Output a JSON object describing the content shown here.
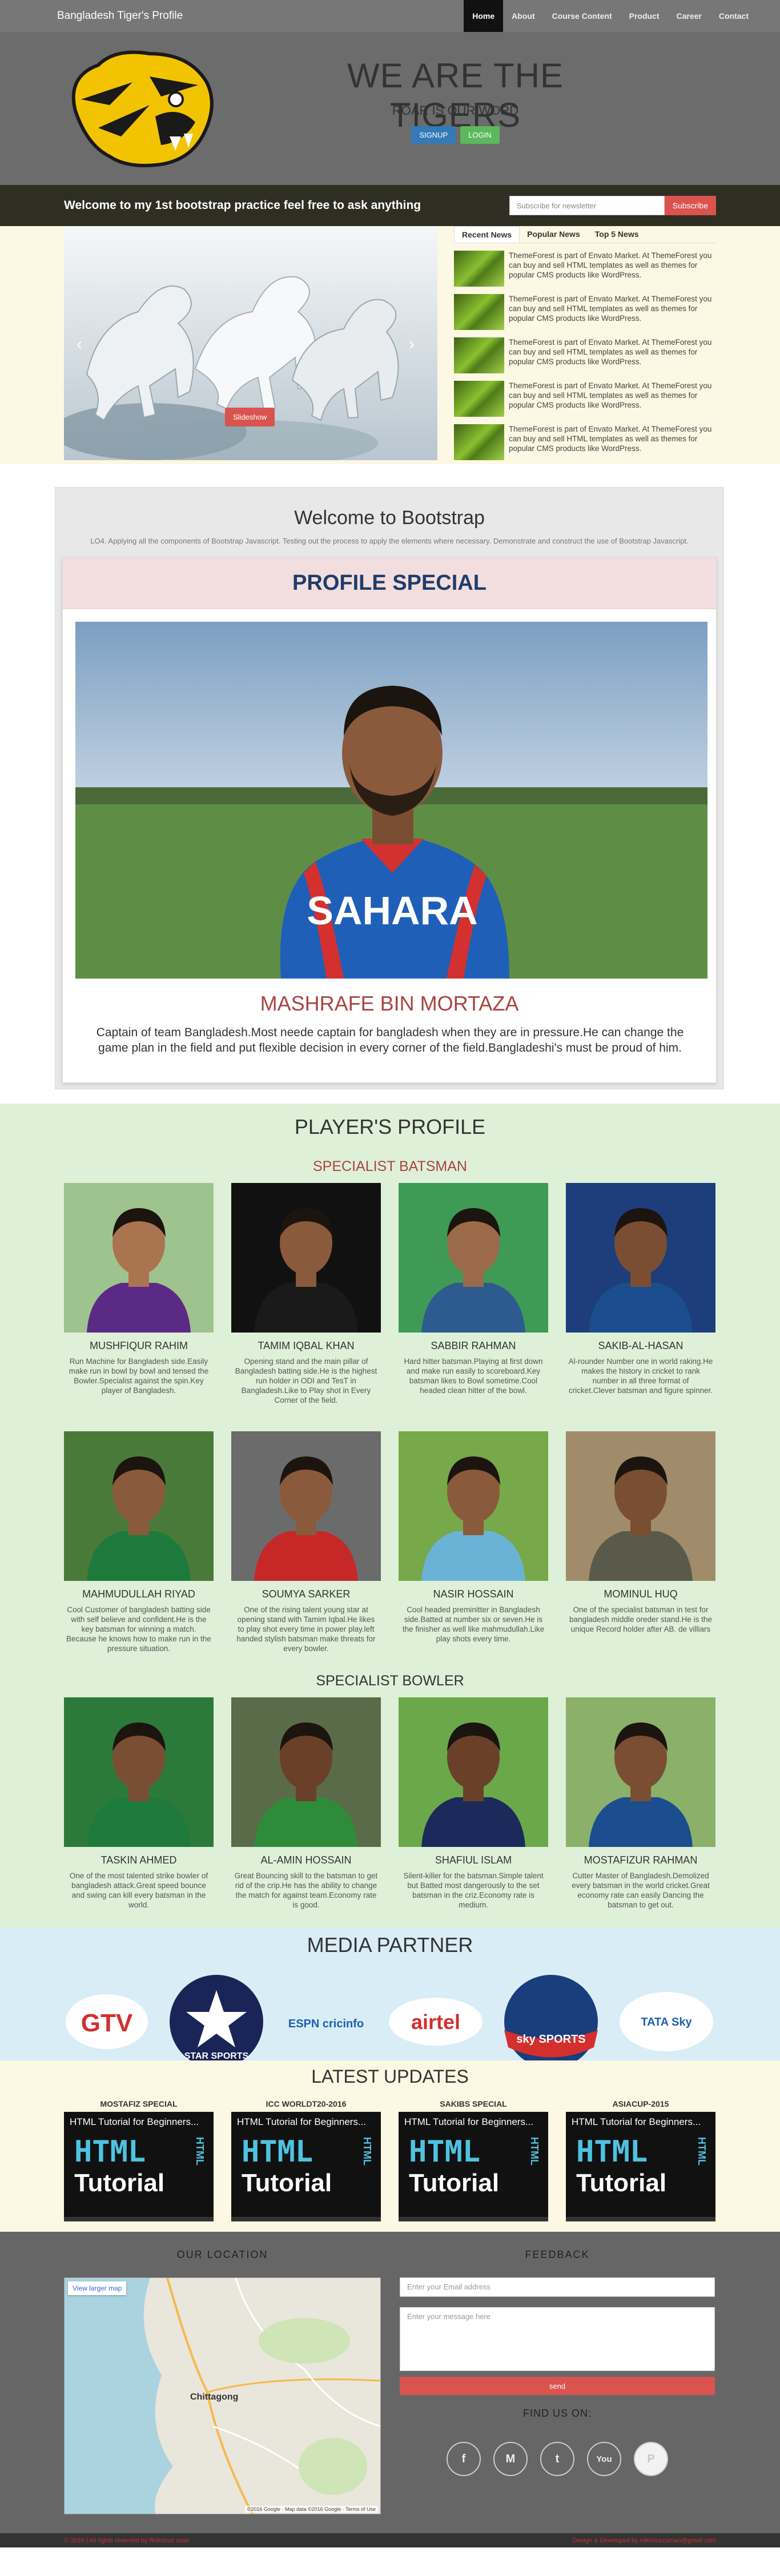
{
  "nav": {
    "brand": "Bangladesh Tiger's Profile",
    "links": [
      "Home",
      "About",
      "Course Content",
      "Product",
      "Career",
      "Contact"
    ]
  },
  "hero": {
    "title": "WE ARE THE TIGERS",
    "subtitle": "ROAR IS OUR WORD",
    "signup": "SIGNUP",
    "login": "LOGIN"
  },
  "welcome_bar": {
    "text": "Welcome to my 1st bootstrap practice feel free to ask anything",
    "placeholder": "Subscribe for newsletter",
    "button": "Subscribe"
  },
  "carousel": {
    "button": "Slideshow",
    "prev": "‹",
    "next": "›"
  },
  "news": {
    "tabs": [
      "Recent News",
      "Popular News",
      "Top 5 News"
    ],
    "items": [
      "ThemeForest is part of Envato Market. At ThemeForest you can buy and sell HTML templates as well as themes for popular CMS products like WordPress.",
      "ThemeForest is part of Envato Market. At ThemeForest you can buy and sell HTML templates as well as themes for popular CMS products like WordPress.",
      "ThemeForest is part of Envato Market. At ThemeForest you can buy and sell HTML templates as well as themes for popular CMS products like WordPress.",
      "ThemeForest is part of Envato Market. At ThemeForest you can buy and sell HTML templates as well as themes for popular CMS products like WordPress.",
      "ThemeForest is part of Envato Market. At ThemeForest you can buy and sell HTML templates as well as themes for popular CMS products like WordPress."
    ]
  },
  "bootstrap": {
    "title": "Welcome to Bootstrap",
    "description": "LO4. Applying all the components of Bootstrap Javascript. Testing out the process to apply the elements where necessary. Demonstrate and construct the use of Bootstrap Javascript."
  },
  "profile": {
    "heading": "PROFILE SPECIAL",
    "jersey": "SAHARA",
    "name": "MASHRAFE BIN MORTAZA",
    "text": "Captain of team Bangladesh.Most neede captain for bangladesh when they are in pressure.He can change the game plan in the field and put flexible decision in every corner of the field.Bangladeshi's must be proud of him."
  },
  "players": {
    "title": "PLAYER'S PROFILE",
    "batsman_title": "SPECIALIST BATSMAN",
    "bowler_title": "SPECIALIST BOWLER",
    "batsmen": [
      {
        "name": "MUSHFIQUR RAHIM",
        "desc": "Run Machine for Bangladesh side.Easily make run in bowl by bowl and tensed the Bowler.Specialist against the spin.Key player of Bangladesh.",
        "bg": "#9fc38f",
        "shirt": "#5b2a86",
        "skin": "#a9744f"
      },
      {
        "name": "TAMIM IQBAL KHAN",
        "desc": "Opening stand and the main pillar of Bangladesh batting side.He is the highest run holder in ODI and TesT in Bangladesh.Like to Play shot in Every Corner of the field.",
        "bg": "#111111",
        "shirt": "#1a1a1a",
        "skin": "#8a5a3c"
      },
      {
        "name": "SABBIR RAHMAN",
        "desc": "Hard hitter batsman.Playing at first down and make run easily to scoreboard.Key batsman likes to Bowl sometime.Cool headed clean hitter of the bowl.",
        "bg": "#3f9a55",
        "shirt": "#2d5b8f",
        "skin": "#9a6a4a"
      },
      {
        "name": "SAKIB-AL-HASAN",
        "desc": "Al-rounder Number one in world raking.He makes the history in cricket to rank number in all three format of cricket.Clever batsman and figure spinner.",
        "bg": "#1d3e7a",
        "shirt": "#1b4d8f",
        "skin": "#7a4e33"
      },
      {
        "name": "MAHMUDULLAH RIYAD",
        "desc": "Cool Customer of bangladesh batting side with self believe and confident.He is the key batsman for winning a match. Because he knows how to make run in the pressure situation.",
        "bg": "#4a7a3a",
        "shirt": "#1e7a3c",
        "skin": "#8a5a3c"
      },
      {
        "name": "SOUMYA SARKER",
        "desc": "One of the rising talent young star at opening stand with Tamim Iqbal.He likes to play shot every time in power play.left handed stylish batsman make threats for every bowler.",
        "bg": "#6b6b6b",
        "shirt": "#c62828",
        "skin": "#8a5a3c"
      },
      {
        "name": "NASIR HOSSAIN",
        "desc": "Cool headed preminitter in Bangladesh side.Batted at number six or seven.He is the finisher as well like mahmudullah.Like play shots every time.",
        "bg": "#77a84a",
        "shirt": "#6bb3d6",
        "skin": "#8a5a3c"
      },
      {
        "name": "MOMINUL HUQ",
        "desc": "One of the specialist batsman in test for bangladesh middle oreder stand.He is the unique Record holder after AB. de villiars",
        "bg": "#a08c6a",
        "shirt": "#5a5a4a",
        "skin": "#7a4e33"
      }
    ],
    "bowlers": [
      {
        "name": "TASKIN AHMED",
        "desc": "One of the most talented strike bowler of bangladesh attack.Great speed bounce and swing can kill every batsman in the world.",
        "bg": "#2c7a3a",
        "shirt": "#1e7a3c",
        "skin": "#7a4e33"
      },
      {
        "name": "AL-AMIN HOSSAIN",
        "desc": "Great Bouncing skill to the batsman to get rid of the crip.He has the ability to change the match for against team.Economy rate is good.",
        "bg": "#5a6b4a",
        "shirt": "#2e8b3a",
        "skin": "#6a4028"
      },
      {
        "name": "SHAFIUL ISLAM",
        "desc": "Silent-killer for the batsman.Simple talent but Batted most dangerously to the set batsman in the criz.Economy rate is medium.",
        "bg": "#6aa84a",
        "shirt": "#1b2a5a",
        "skin": "#6a4028"
      },
      {
        "name": "MOSTAFIZUR RAHMAN",
        "desc": "Cutter Master of Bangladesh.Demolized every batsman in the world cricket.Great economy rate can easily Dancing the batsman to get out.",
        "bg": "#8ab06a",
        "shirt": "#1b4d8f",
        "skin": "#7a4e33"
      }
    ]
  },
  "media": {
    "title": "MEDIA PARTNER",
    "partners": [
      "GTV",
      "STAR SPORTS",
      "ESPN cricinfo",
      "airtel",
      "sky SPORTS",
      "TATA Sky"
    ]
  },
  "updates": {
    "title": "LATEST UPDATES",
    "items": [
      {
        "label": "MOSTAFIZ SPECIAL",
        "video": "HTML Tutorial for Beginners..."
      },
      {
        "label": "ICC WORLDT20-2016",
        "video": "HTML Tutorial for Beginners..."
      },
      {
        "label": "SAKIBS SPECIAL",
        "video": "HTML Tutorial for Beginners..."
      },
      {
        "label": "ASIACUP-2015",
        "video": "HTML Tutorial for Beginners..."
      }
    ],
    "big_word": "HTML",
    "tutorial_word": "Tutorial"
  },
  "footer": {
    "location_title": "OUR LOCATION",
    "map_button": "View larger map",
    "map_city": "Chittagong",
    "map_credit": "©2016 Google · Map data ©2016 Google · Terms of Use",
    "feedback_title": "FEEDBACK",
    "email_placeholder": "Enter your Email address",
    "message_placeholder": "Enter your message here",
    "send": "send",
    "find_us": "FIND US ON:",
    "social": [
      "f",
      "M",
      "t",
      "You",
      "P"
    ],
    "copy_left": "© 2016 | All rights reserved by Rokonuz zaan",
    "copy_right": "Design & Developed by rokonuzzaman@gmail.com"
  }
}
